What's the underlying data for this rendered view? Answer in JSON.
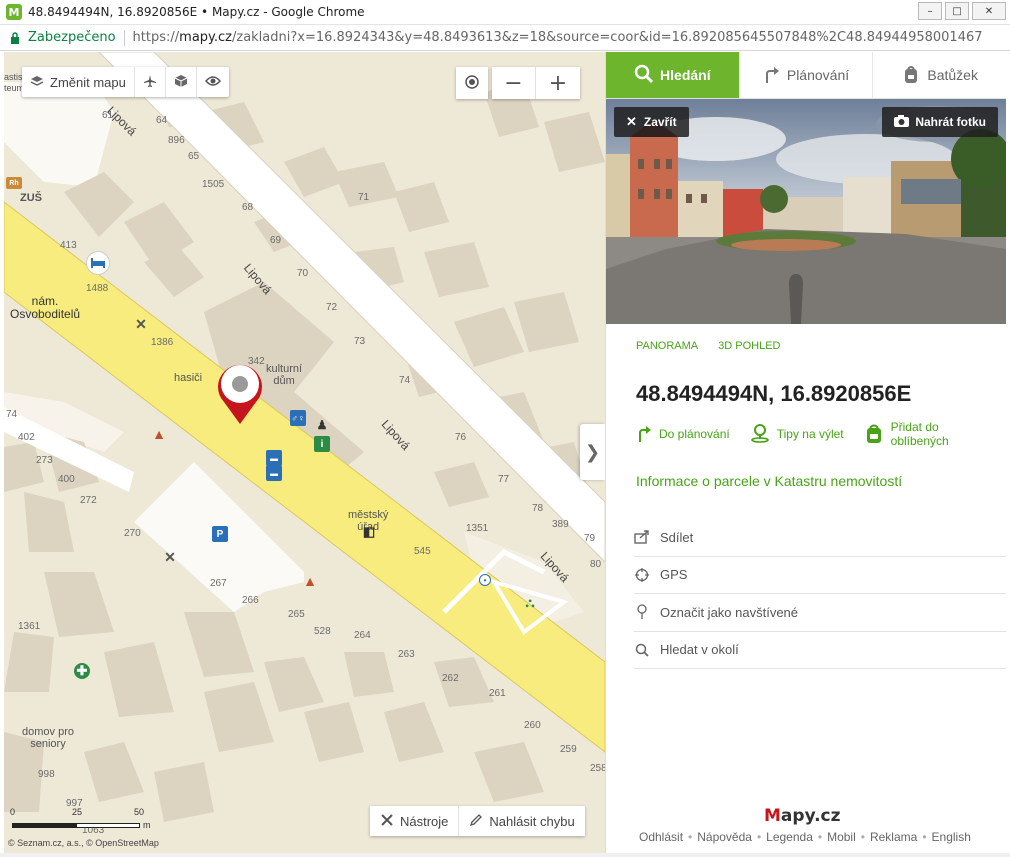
{
  "window": {
    "title": "48.8494494N, 16.8920856E • Mapy.cz - Google Chrome",
    "app_icon_letter": "M",
    "minimize": "–",
    "maximize": "□",
    "close": "✕"
  },
  "addressbar": {
    "secure_label": "Zabezpečeno",
    "url_scheme": "https://",
    "url_host": "mapy.cz",
    "url_path": "/zakladni?x=16.8924343&y=48.8493613&z=18&source=coor&id=16.892085645507848%2C48.84944958001467"
  },
  "map": {
    "toolbar": {
      "change_map_label": "Změnit mapu",
      "icons": [
        "airplane-icon",
        "cube-icon",
        "eye-icon"
      ]
    },
    "zoom": {
      "minus": "−",
      "plus": "+"
    },
    "collapse": "❯",
    "bottom_tools": {
      "tools_label": "Nástroje",
      "report_label": "Nahlásit chybu"
    },
    "scale": {
      "l0": "0",
      "l25": "25",
      "l50": "50",
      "unit": "m"
    },
    "copyright": "© Seznam.cz, a.s., © OpenStreetMap",
    "labels": {
      "street1": "Lipová",
      "street2": "Lipová",
      "street3": "Lipová",
      "street4": "Lipová",
      "square": "nám.\nOsvoboditelů",
      "hasici": "hasiči",
      "kulturni": "kulturní\ndům",
      "mestsky": "městský\núřad",
      "domov": "domov pro\nseniory",
      "zus": "ZUŠ",
      "corner": "astis\nteum",
      "numbers": {
        "n61": "61",
        "n64": "64",
        "n896": "896",
        "n65": "65",
        "n1505": "1505",
        "n68": "68",
        "n69": "69",
        "n70": "70",
        "n71": "71",
        "n72": "72",
        "n73": "73",
        "n74": "74",
        "n76": "76",
        "n77": "77",
        "n78": "78",
        "n389": "389",
        "n79": "79",
        "n80": "80",
        "n1351": "1351",
        "n545": "545",
        "n342": "342",
        "n413": "413",
        "n1488": "1488",
        "n1386": "1386",
        "n74b": "74",
        "n402": "402",
        "n273": "273",
        "n400": "400",
        "n272": "272",
        "n270": "270",
        "n267": "267",
        "n266": "266",
        "n265": "265",
        "n528": "528",
        "n264": "264",
        "n263": "263",
        "n262": "262",
        "n261": "261",
        "n260": "260",
        "n259": "259",
        "n258": "258",
        "n1361": "1361",
        "n998": "998",
        "n997": "997",
        "n1063": "1063"
      }
    }
  },
  "panel": {
    "tabs": [
      {
        "label": "Hledání",
        "icon": "search-icon"
      },
      {
        "label": "Plánování",
        "icon": "route-icon"
      },
      {
        "label": "Batůžek",
        "icon": "backpack-icon"
      }
    ],
    "photo": {
      "close_label": "Zavřít",
      "upload_label": "Nahrát fotku"
    },
    "view_links": {
      "panorama": "PANORAMA",
      "view3d": "3D POHLED"
    },
    "coordinates": "48.8494494N, 16.8920856E",
    "actions": {
      "plan": "Do plánování",
      "trip": "Tipy na výlet",
      "fav": "Přidat do\noblíbených"
    },
    "cadastre_link": "Informace o parcele v Katastru nemovitostí",
    "menu": [
      {
        "label": "Sdílet",
        "icon": "share-icon"
      },
      {
        "label": "GPS",
        "icon": "gps-icon"
      },
      {
        "label": "Označit jako navštívené",
        "icon": "visited-pin-icon"
      },
      {
        "label": "Hledat v okolí",
        "icon": "search-icon"
      }
    ],
    "logo": {
      "m": "M",
      "rest": "apy.cz"
    },
    "footer": [
      "Odhlásit",
      "Nápověda",
      "Legenda",
      "Mobil",
      "Reklama",
      "English"
    ]
  },
  "colors": {
    "accent": "#6cb52d",
    "link": "#4aa317",
    "main_road": "#f7ec7d",
    "map_bg": "#eee8d7",
    "building": "#dcd3c1",
    "marker": "#c4161c"
  }
}
